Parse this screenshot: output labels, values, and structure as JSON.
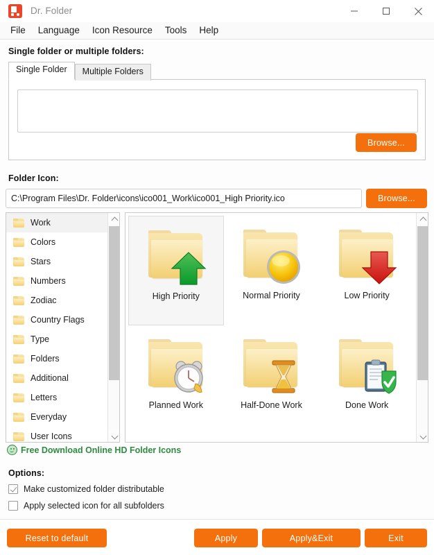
{
  "window": {
    "title": "Dr. Folder",
    "app_icon": "dr-folder-logo-icon",
    "minimize": "minimize-icon",
    "maximize": "maximize-icon",
    "close": "close-icon"
  },
  "menubar": {
    "items": [
      {
        "label": "File"
      },
      {
        "label": "Language"
      },
      {
        "label": "Icon Resource"
      },
      {
        "label": "Tools"
      },
      {
        "label": "Help"
      }
    ]
  },
  "folder_section": {
    "label": "Single folder or multiple folders:",
    "tabs": [
      {
        "label": "Single Folder",
        "active": true
      },
      {
        "label": "Multiple Folders",
        "active": false
      }
    ],
    "input_value": "",
    "input_placeholder": "",
    "browse_label": "Browse..."
  },
  "icon_section": {
    "label": "Folder Icon:",
    "path_value": "C:\\Program Files\\Dr. Folder\\icons\\ico001_Work\\ico001_High Priority.ico",
    "path_placeholder": "",
    "browse_label": "Browse..."
  },
  "categories": [
    {
      "label": "Work",
      "selected": true
    },
    {
      "label": "Colors",
      "selected": false
    },
    {
      "label": "Stars",
      "selected": false
    },
    {
      "label": "Numbers",
      "selected": false
    },
    {
      "label": "Zodiac",
      "selected": false
    },
    {
      "label": "Country Flags",
      "selected": false
    },
    {
      "label": "Type",
      "selected": false
    },
    {
      "label": "Folders",
      "selected": false
    },
    {
      "label": "Additional",
      "selected": false
    },
    {
      "label": "Letters",
      "selected": false
    },
    {
      "label": "Everyday",
      "selected": false
    },
    {
      "label": "User Icons",
      "selected": false
    }
  ],
  "icons": [
    {
      "label": "High Priority",
      "badge": "green-up-arrow-icon",
      "selected": true
    },
    {
      "label": "Normal Priority",
      "badge": "yellow-circle-icon",
      "selected": false
    },
    {
      "label": "Low Priority",
      "badge": "red-down-arrow-icon",
      "selected": false
    },
    {
      "label": "Planned Work",
      "badge": "alarm-clock-icon",
      "selected": false
    },
    {
      "label": "Half-Done Work",
      "badge": "hourglass-icon",
      "selected": false
    },
    {
      "label": "Done Work",
      "badge": "clipboard-check-icon",
      "selected": false
    }
  ],
  "free_download": {
    "icon": "green-smiley-icon",
    "label": "Free Download Online HD Folder Icons"
  },
  "options": {
    "label": "Options:",
    "items": [
      {
        "label": "Make customized folder distributable",
        "checked": true
      },
      {
        "label": "Apply selected icon for all subfolders",
        "checked": false
      }
    ]
  },
  "footer": {
    "reset_label": "Reset to default",
    "apply_label": "Apply",
    "apply_exit_label": "Apply&Exit",
    "exit_label": "Exit"
  },
  "colors": {
    "accent": "#f4700c",
    "logo": "#e8472b",
    "link_green": "#2e8b40",
    "folder_yellow": "#f2cf72"
  }
}
